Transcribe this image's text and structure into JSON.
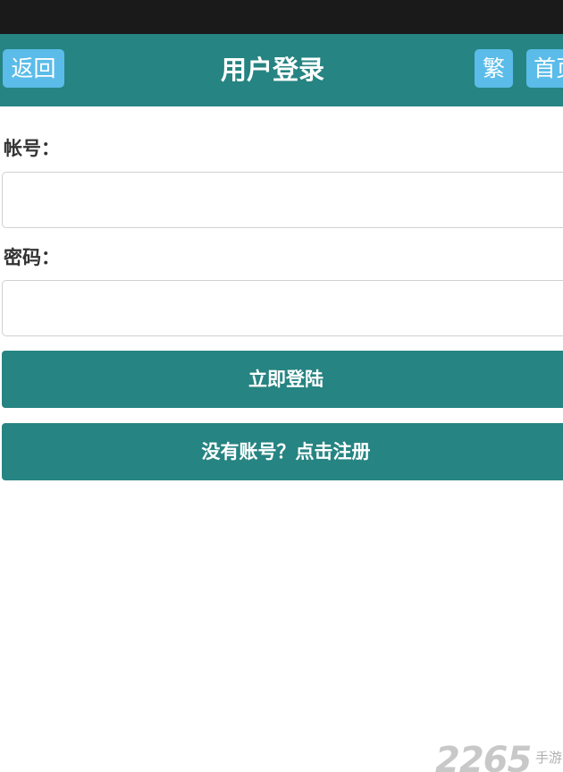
{
  "header": {
    "title": "用户登录",
    "back_label": "返回",
    "traditional_label": "繁",
    "home_label": "首页"
  },
  "form": {
    "account_label": "帐号：",
    "account_value": "",
    "password_label": "密码：",
    "password_value": ""
  },
  "actions": {
    "login_label": "立即登陆",
    "register_label": "没有账号？点击注册"
  },
  "watermark": {
    "number": "2265",
    "tag": "手游"
  },
  "colors": {
    "status_bar": "#1a1a1a",
    "header_bg": "#268482",
    "header_button": "#5bbce9",
    "action_button": "#268482",
    "input_border": "#d0d0d0"
  }
}
